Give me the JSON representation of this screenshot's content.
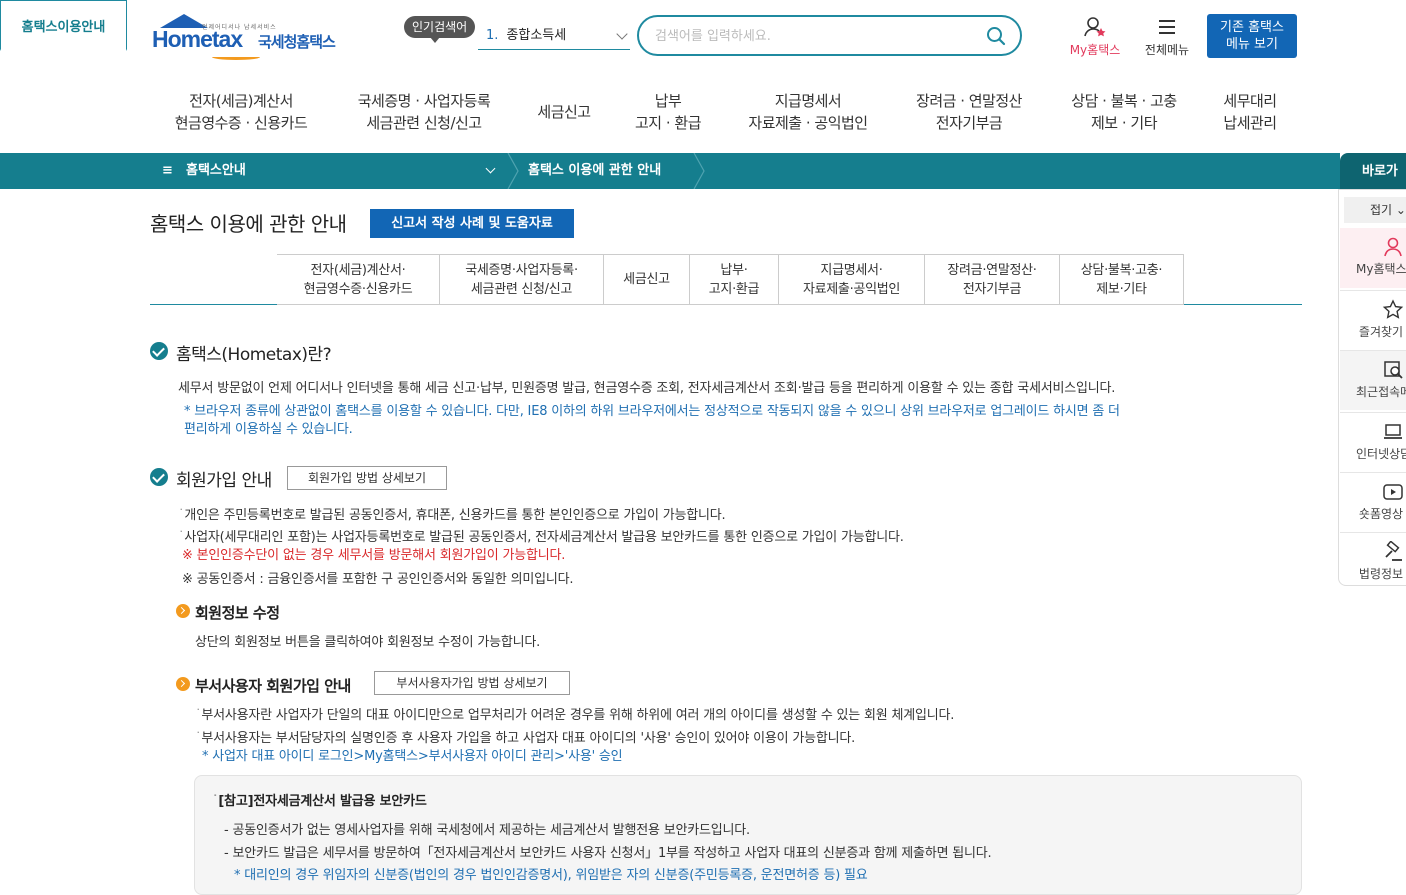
{
  "header": {
    "logo_sub": "언제어디서나 납세서비스",
    "logo_main": "Hometax",
    "logo_kr": "국세청홈택스",
    "popular_label": "인기검색어",
    "popular_rank": "1.",
    "popular_term": "종합소득세",
    "search_placeholder": "검색어를 입력하세요.",
    "my_hometax": "My홈택스",
    "all_menu": "전체메뉴",
    "old_menu_line1": "기존 홈택스",
    "old_menu_line2": "메뉴 보기"
  },
  "gnb": [
    {
      "l1": "전자(세금)계산서",
      "l2": "현금영수증 · 신용카드"
    },
    {
      "l1": "국세증명 · 사업자등록",
      "l2": "세금관련 신청/신고"
    },
    {
      "l1": "세금신고",
      "l2": ""
    },
    {
      "l1": "납부",
      "l2": "고지 · 환급"
    },
    {
      "l1": "지급명세서",
      "l2": "자료제출 · 공익법인"
    },
    {
      "l1": "장려금 · 연말정산",
      "l2": "전자기부금"
    },
    {
      "l1": "상담 · 불복 · 고충",
      "l2": "제보 · 기타"
    },
    {
      "l1": "세무대리",
      "l2": "납세관리"
    }
  ],
  "breadcrumb": {
    "level1": "홈택스안내",
    "level2": "홈택스 이용에 관한 안내"
  },
  "quick": {
    "title": "바로가기",
    "fold": "접기",
    "items": [
      "My홈택스",
      "즐겨찾기",
      "최근접속메뉴",
      "인터넷상담",
      "숏폼영상",
      "법령정보"
    ]
  },
  "page": {
    "title": "홈택스 이용에 관한 안내",
    "guide_button": "신고서 작성 사례 및 도움자료"
  },
  "tabs": [
    {
      "l1": "홈택스이용안내",
      "l2": ""
    },
    {
      "l1": "전자(세금)계산서·",
      "l2": "현금영수증·신용카드"
    },
    {
      "l1": "국세증명·사업자등록·",
      "l2": "세금관련 신청/신고"
    },
    {
      "l1": "세금신고",
      "l2": ""
    },
    {
      "l1": "납부·",
      "l2": "고지·환급"
    },
    {
      "l1": "지급명세서·",
      "l2": "자료제출·공익법인"
    },
    {
      "l1": "장려금·연말정산·",
      "l2": "전자기부금"
    },
    {
      "l1": "상담·불복·고충·",
      "l2": "제보·기타"
    }
  ],
  "section1": {
    "title": "홈택스(Hometax)란?",
    "desc": "세무서 방문없이 언제 어디서나 인터넷을 통해 세금 신고·납부, 민원증명 발급, 현금영수증 조회, 전자세금계산서 조회·발급 등을 편리하게 이용할 수 있는 종합 국세서비스입니다.",
    "note1": "* 브라우저 종류에 상관없이 홈택스를 이용할 수 있습니다. 다만, IE8 이하의 하위 브라우저에서는 정상적으로 작동되지 않을 수 있으니 상위 브라우저로 업그레이드 하시면 좀 더",
    "note2": "편리하게 이용하실 수 있습니다."
  },
  "section2": {
    "title": "회원가입 안내",
    "detail_button": "회원가입 방법 상세보기",
    "item1": "개인은 주민등록번호로 발급된 공동인증서, 휴대폰, 신용카드를 통한 본인인증으로 가입이 가능합니다.",
    "item2": "사업자(세무대리인 포함)는 사업자등록번호로 발급된 공동인증서, 전자세금계산서 발급용 보안카드를 통한 인증으로 가입이 가능합니다.",
    "warn": "※ 본인인증수단이 없는 경우 세무서를 방문해서 회원가입이 가능합니다.",
    "note": "※ 공동인증서 : 금융인증서를 포함한 구 공인인증서와 동일한 의미입니다.",
    "sub1_title": "회원정보 수정",
    "sub1_desc": "상단의 회원정보 버튼을 클릭하여야 회원정보 수정이 가능합니다.",
    "sub2_title": "부서사용자 회원가입 안내",
    "sub2_button": "부서사용자가입 방법 상세보기",
    "sub2_item1": "부서사용자란 사업자가 단일의 대표 아이디만으로 업무처리가 어려운 경우를 위해 하위에 여러 개의 아이디를 생성할 수 있는 회원 체계입니다.",
    "sub2_item2": "부서사용자는 부서담당자의 실명인증 후 사용자 가입을 하고 사업자 대표 아이디의 '사용' 승인이 있어야 이용이 가능합니다.",
    "sub2_note": "* 사업자 대표 아이디 로그인>My홈택스>부서사용자 아이디 관리>'사용' 승인"
  },
  "reference": {
    "title": "[참고]전자세금계산서 발급용 보안카드",
    "line1": "공동인증서가 없는 영세사업자를 위해 국세청에서 제공하는 세금계산서 발행전용 보안카드입니다.",
    "line2": "보안카드 발급은 세무서를 방문하여「전자세금계산서 보안카드 사용자 신청서」1부를 작성하고 사업자 대표의 신분증과 함께 제출하면 됩니다.",
    "note": "* 대리인의 경우 위임자의 신분증(법인의 경우 법인인감증명서), 위임받은 자의 신분증(주민등록증, 운전면허증 등) 필요"
  },
  "colors": {
    "teal": "#157e8e",
    "blue": "#1266b5",
    "orange": "#f39a1e",
    "red": "#d9292b"
  }
}
